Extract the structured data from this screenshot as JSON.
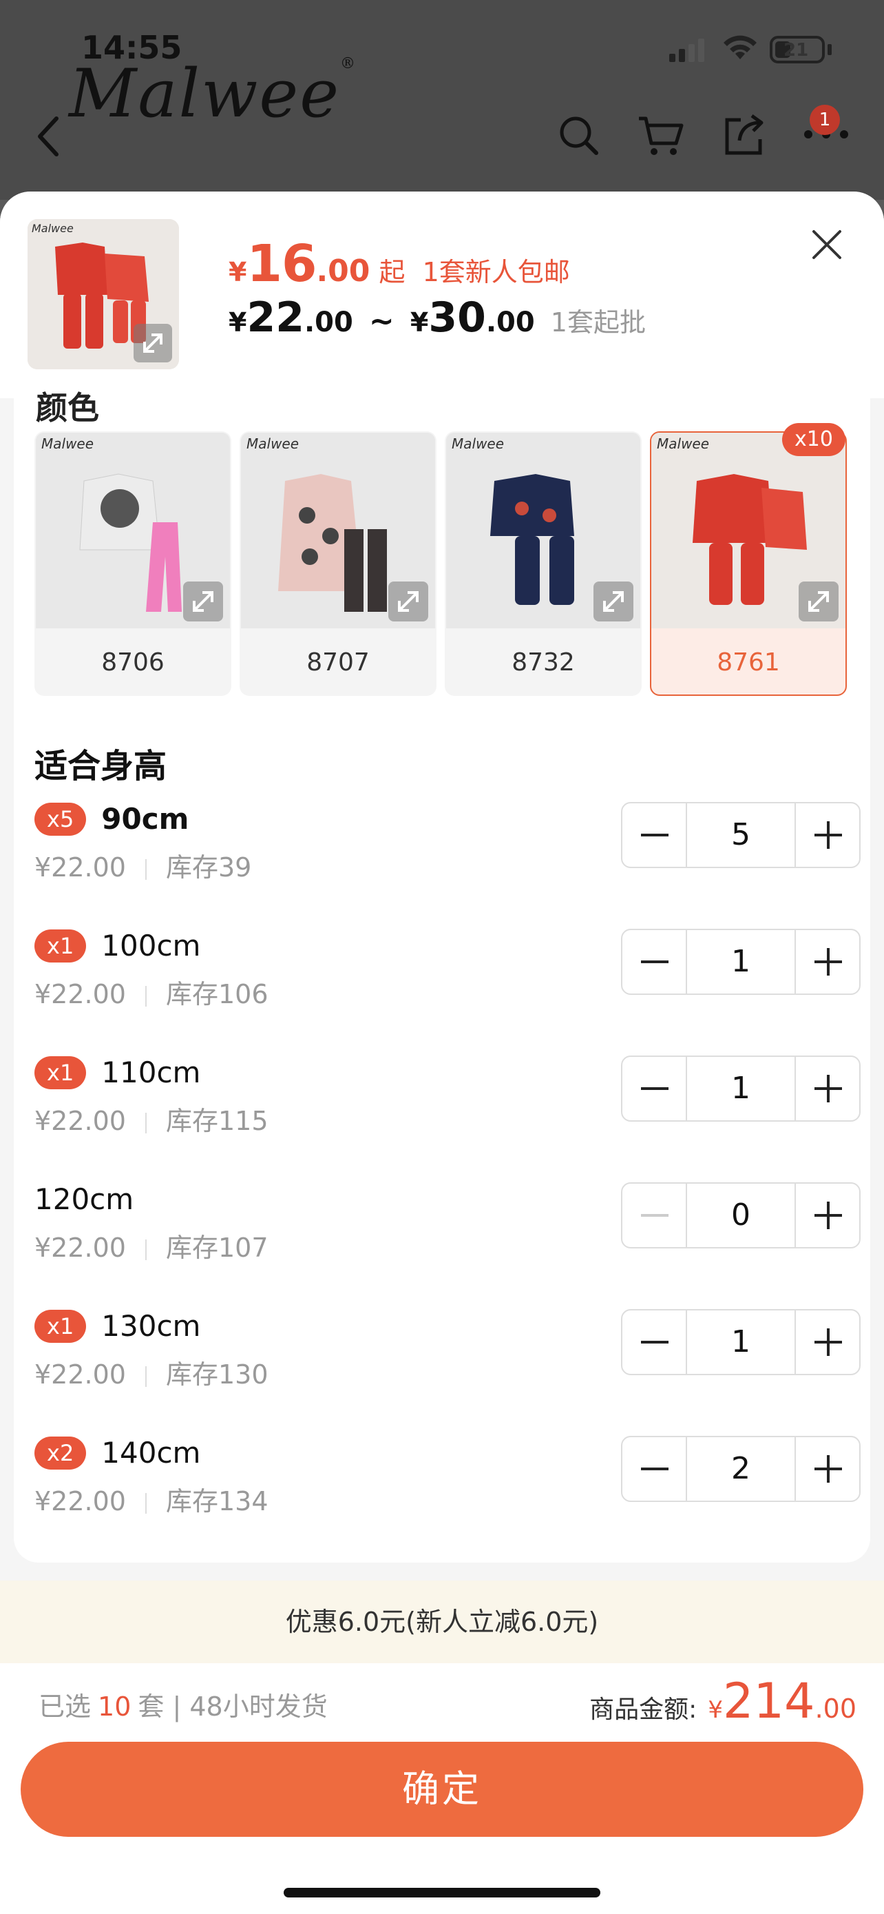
{
  "status": {
    "time": "14:55",
    "battery": "21"
  },
  "brand": {
    "logo_text": "Malwee"
  },
  "nav": {
    "badge_count": "1"
  },
  "header": {
    "promo_price_currency": "¥",
    "promo_price_int": "16",
    "promo_price_dec": ".00",
    "promo_suffix": "起",
    "promo_note": "1套新人包邮",
    "range_low_currency": "¥",
    "range_low_int": "22",
    "range_low_dec": ".00",
    "range_sep": "~",
    "range_high_currency": "¥",
    "range_high_int": "30",
    "range_high_dec": ".00",
    "min_order": "1套起批"
  },
  "section_color_title": "颜色",
  "colors": [
    {
      "label": "8706",
      "selected": false,
      "badge": ""
    },
    {
      "label": "8707",
      "selected": false,
      "badge": ""
    },
    {
      "label": "8732",
      "selected": false,
      "badge": ""
    },
    {
      "label": "8761",
      "selected": true,
      "badge": "x10"
    }
  ],
  "height_title": "适合身高",
  "sizes": [
    {
      "tag": "x5",
      "name": "90cm",
      "price": "¥22.00",
      "stock": "库存39",
      "qty": "5",
      "bold": true
    },
    {
      "tag": "x1",
      "name": "100cm",
      "price": "¥22.00",
      "stock": "库存106",
      "qty": "1",
      "bold": false
    },
    {
      "tag": "x1",
      "name": "110cm",
      "price": "¥22.00",
      "stock": "库存115",
      "qty": "1",
      "bold": false
    },
    {
      "tag": "",
      "name": "120cm",
      "price": "¥22.00",
      "stock": "库存107",
      "qty": "0",
      "bold": false
    },
    {
      "tag": "x1",
      "name": "130cm",
      "price": "¥22.00",
      "stock": "库存130",
      "qty": "1",
      "bold": false
    },
    {
      "tag": "x2",
      "name": "140cm",
      "price": "¥22.00",
      "stock": "库存134",
      "qty": "2",
      "bold": false
    }
  ],
  "promo_bar": "优惠6.0元(新人立减6.0元)",
  "summary": {
    "selected_prefix": "已选",
    "selected_qty": "10",
    "selected_suffix": "套 | 48小时发货",
    "amount_label": "商品金额:",
    "amount_currency": "¥",
    "amount_int": "214",
    "amount_dec": ".00"
  },
  "confirm_label": "确定",
  "colors_theme": {
    "accent": "#e8553a",
    "button": "#ee6b3f"
  }
}
